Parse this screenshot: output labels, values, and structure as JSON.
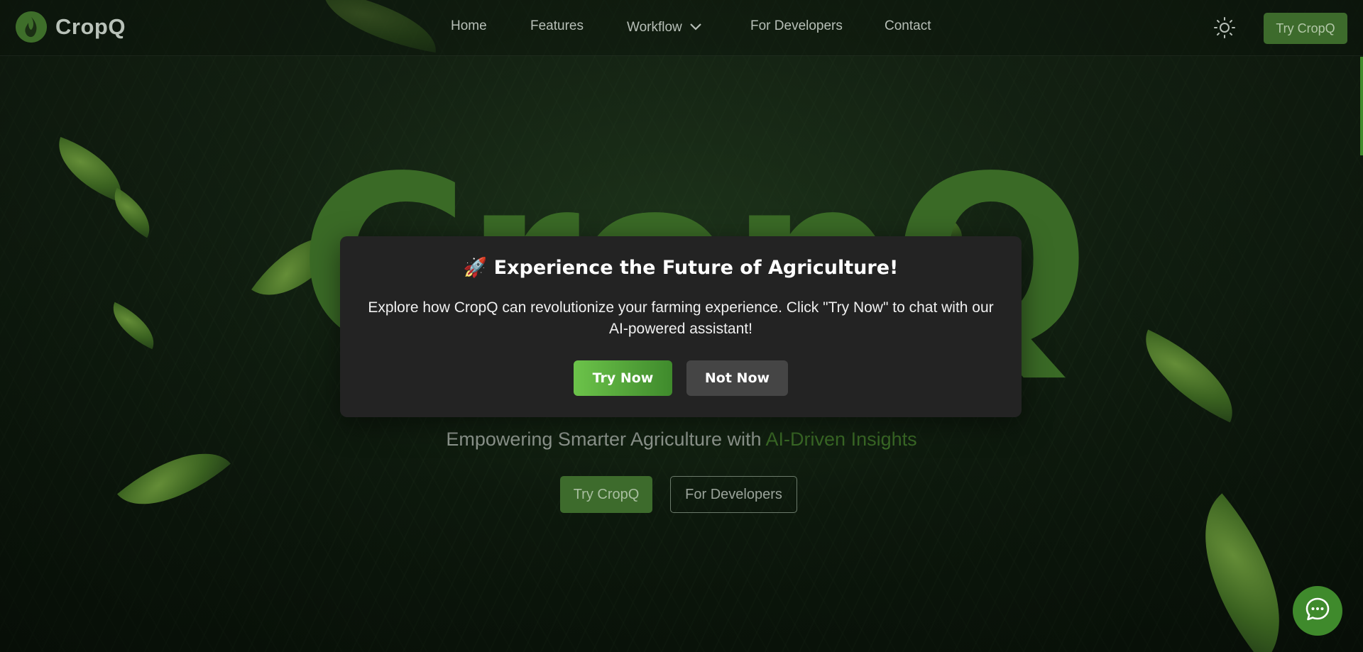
{
  "brand": {
    "name": "CropQ",
    "logo_icon": "leaf-flame-icon"
  },
  "nav": {
    "items": [
      {
        "label": "Home"
      },
      {
        "label": "Features"
      },
      {
        "label": "Workflow",
        "icon": "chevron-down-icon"
      },
      {
        "label": "For Developers"
      },
      {
        "label": "Contact"
      }
    ],
    "theme_toggle_icon": "sun-icon",
    "cta_label": "Try CropQ"
  },
  "hero": {
    "title": "CropQ",
    "subtitle_prefix": "Empowering Smarter Agriculture with ",
    "subtitle_accent": "AI-Driven Insights",
    "primary_button": "Try CropQ",
    "secondary_button": "For Developers"
  },
  "modal": {
    "title": "🚀 Experience the Future of Agriculture!",
    "body": "Explore how CropQ can revolutionize your farming experience. Click \"Try Now\" to chat with our AI-powered assistant!",
    "try_label": "Try Now",
    "dismiss_label": "Not Now"
  },
  "chat": {
    "icon": "chat-bubble-icon"
  },
  "colors": {
    "accent": "#3f8a2c",
    "brand_green": "#3a6a26",
    "modal_bg": "#232323"
  }
}
